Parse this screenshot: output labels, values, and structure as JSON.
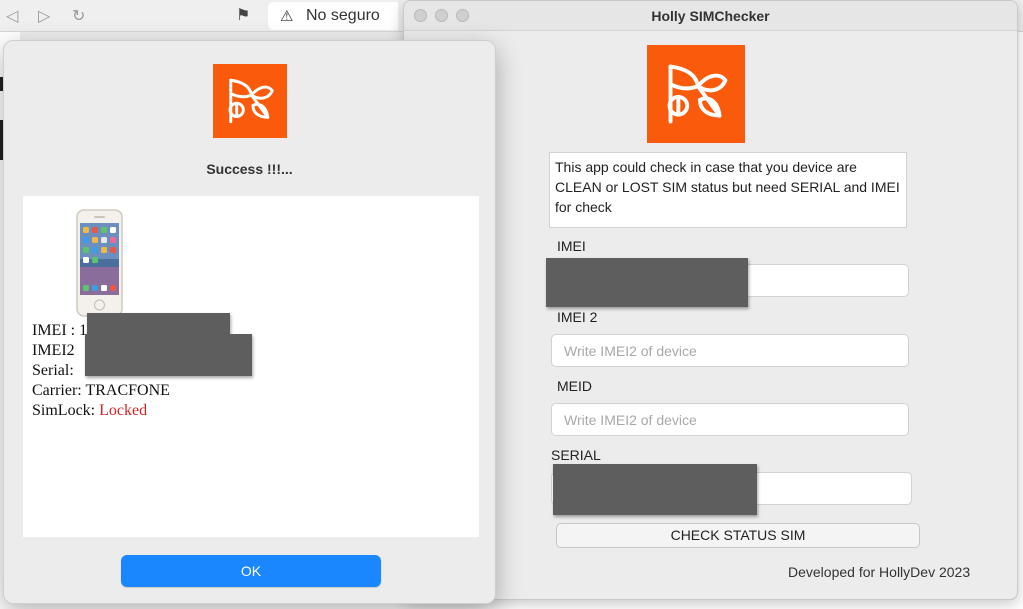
{
  "browser": {
    "address_text": "No seguro"
  },
  "app": {
    "title": "Holly SIMChecker",
    "brand_color": "#fa5a0c",
    "description": "This app could check in case that you device are CLEAN or LOST SIM status but need SERIAL and IMEI for check",
    "fields": [
      {
        "label": "IMEI",
        "value": "",
        "placeholder": ""
      },
      {
        "label": "IMEI 2",
        "value": "",
        "placeholder": "Write IMEI2 of device"
      },
      {
        "label": "MEID",
        "value": "",
        "placeholder": "Write IMEI2 of device"
      },
      {
        "label": "SERIAL",
        "value": "",
        "placeholder": ""
      }
    ],
    "check_button": "CHECK STATUS SIM",
    "footer": "Developed for HollyDev 2023"
  },
  "dialog": {
    "title": "Success !!!...",
    "result": {
      "imei_label": "IMEI : ",
      "imei_prefix": "1",
      "imei2_label": "IMEI2",
      "serial_label": "Serial: ",
      "carrier_label": "Carrier: ",
      "carrier_value": "TRACFONE",
      "simlock_label": "SimLock: ",
      "simlock_value": "Locked",
      "simlock_color": "#d62424"
    },
    "ok_button": "OK",
    "ok_color": "#1a86ff"
  }
}
